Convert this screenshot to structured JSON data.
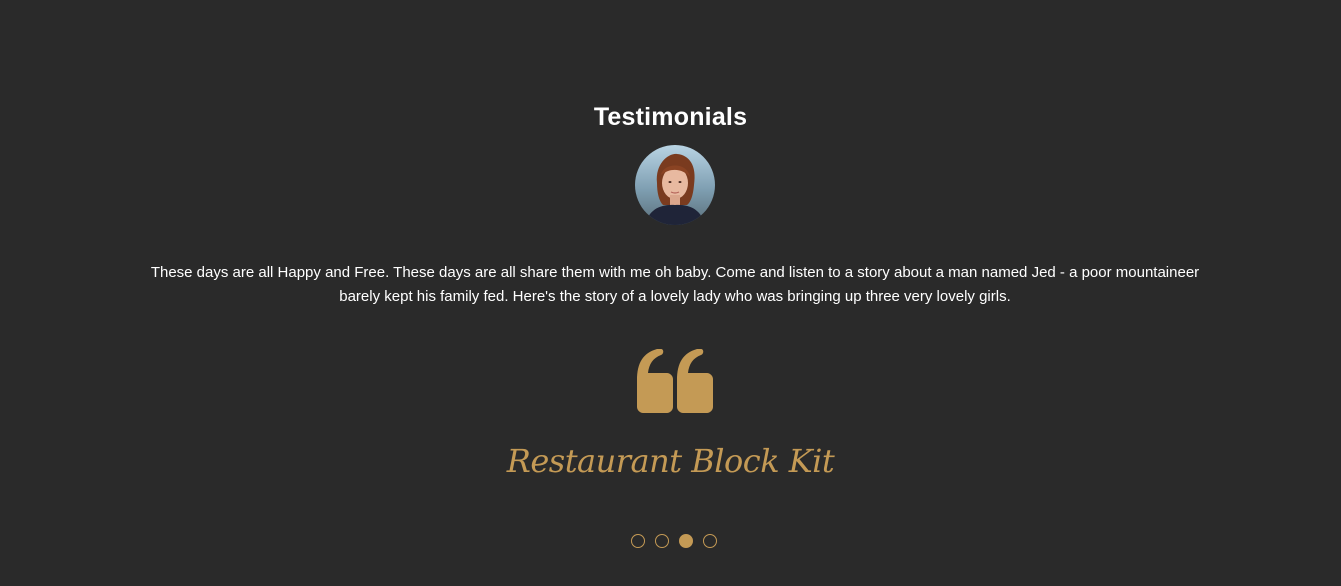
{
  "testimonials": {
    "heading": "Testimonials",
    "avatar": "avatar-photo-woman",
    "quote_line_1": "These days are all Happy and Free. These days are all share them with me oh baby. Come and listen to a story about a man named Jed - a poor mountaineer",
    "quote_line_2": "barely kept his family fed. Here's the story of a lovely lady who was bringing up three very lovely girls.",
    "quote_icon": "quote-icon",
    "signature": "Restaurant Block Kit",
    "slider": {
      "slide_count": 4,
      "active_index": 2
    }
  },
  "colors": {
    "background": "#2a2a2a",
    "text": "#ffffff",
    "accent": "#c49a55"
  }
}
